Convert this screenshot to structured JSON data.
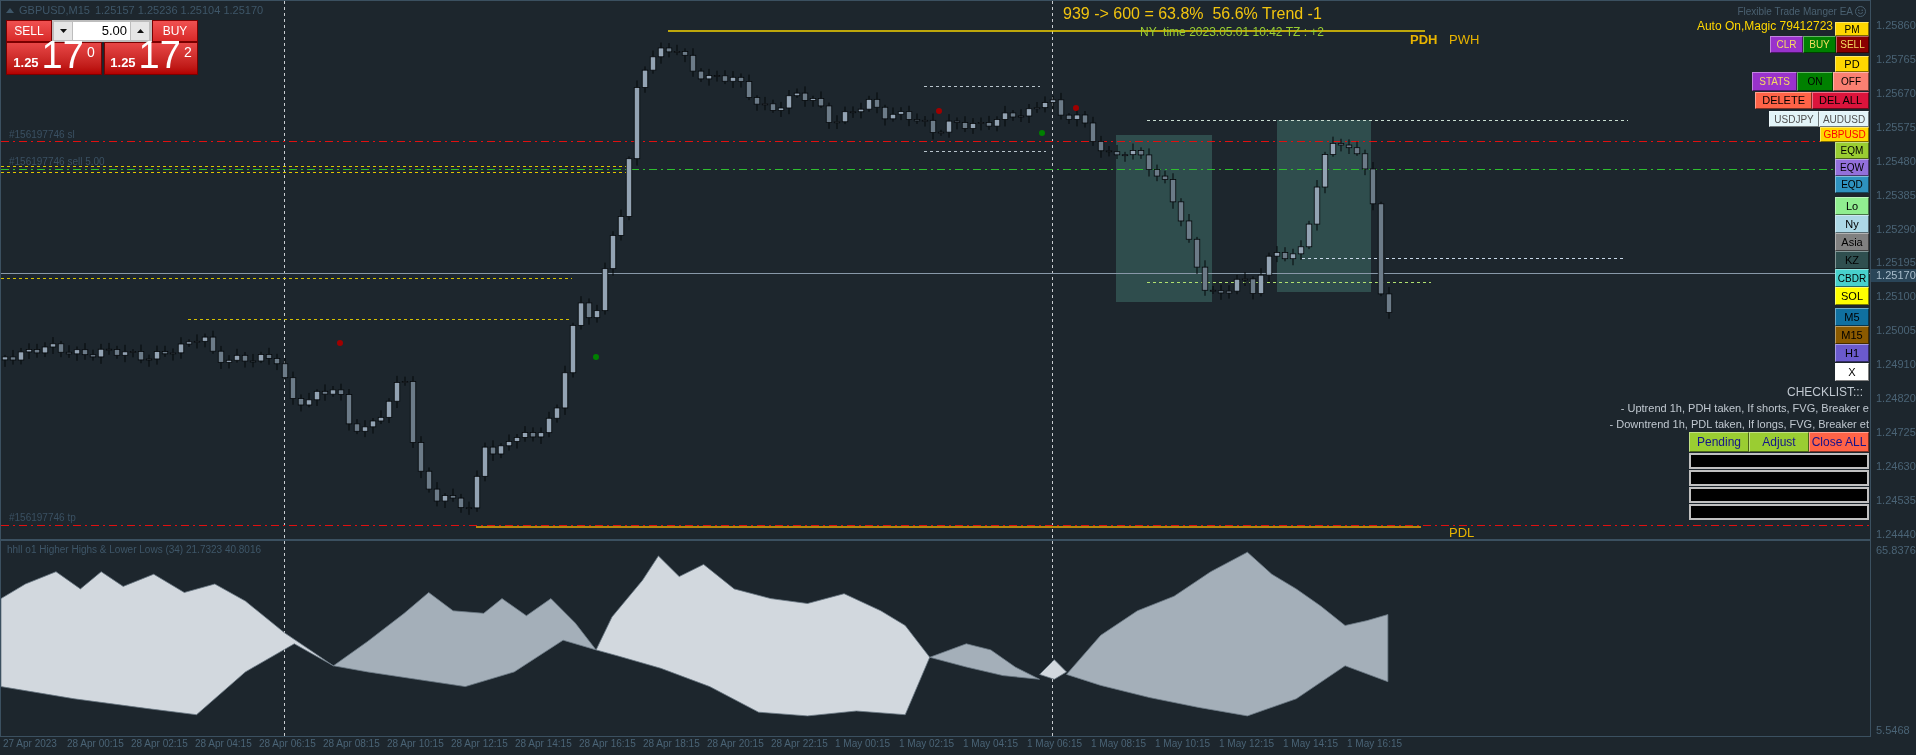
{
  "chart_header": {
    "symbol": "GBPUSD,M15",
    "quote": "1.25157 1.25236 1.25104 1.25170"
  },
  "one_click_trading": {
    "sell": {
      "label": "SELL",
      "price_prefix": "1.25",
      "price_pips": "17",
      "price_fraction": "0"
    },
    "buy": {
      "label": "BUY",
      "price_prefix": "1.25",
      "price_pips": "17",
      "price_fraction": "2"
    },
    "lot": "5.00"
  },
  "summary_text": "939 -> 600 = 63.8%  56.6% Trend -1",
  "session_time": "NY  time 2023.05.01 10:42 TZ : +2",
  "level_labels": [
    "PDH",
    "PWH",
    "PDL"
  ],
  "order_labels": [
    "#156197746 sl",
    "#156197746 sell 5.00",
    "#156197746 tp"
  ],
  "signal_dots": [
    {
      "color": "#a00000"
    },
    {
      "color": "#008000"
    },
    {
      "color": "#a00000"
    },
    {
      "color": "#008000"
    },
    {
      "color": "#a00000"
    }
  ],
  "ea_panel": {
    "title": "Flexible Trade Manger EA",
    "status": "Auto On,Magic 79412723",
    "button_rows": [
      [
        {
          "label": "PM",
          "kind": "plain",
          "color": "#ffd700"
        }
      ],
      [
        {
          "label": "CLR",
          "kind": "accent",
          "color": "#9932cc"
        },
        {
          "label": "BUY",
          "kind": "accent",
          "color": "#008000"
        },
        {
          "label": "SELL",
          "kind": "accent",
          "color": "#8b0000"
        }
      ],
      [
        {
          "label": "PD",
          "kind": "plain",
          "color": "#ffd700"
        }
      ],
      [
        {
          "label": "STATS",
          "kind": "accent",
          "color": "#9932cc"
        },
        {
          "label": "ON",
          "kind": "plain",
          "color": "#008000"
        },
        {
          "label": "OFF",
          "kind": "plain",
          "color": "#fa8072"
        }
      ],
      [
        {
          "label": "DELETE",
          "kind": "plain",
          "color": "#ff6347"
        },
        {
          "label": "DEL ALL",
          "kind": "plain",
          "color": "#dc143c"
        }
      ],
      [
        {
          "label": "USDJPY",
          "kind": "symbol",
          "selected": false
        },
        {
          "label": "AUDUSD",
          "kind": "symbol",
          "selected": false
        }
      ],
      [
        {
          "label": "GBPUSD",
          "kind": "symbol",
          "selected": true
        }
      ],
      [
        {
          "label": "EQM",
          "kind": "plain",
          "color": "#9acd32"
        }
      ],
      [
        {
          "label": "EQW",
          "kind": "plain",
          "color": "#9370db"
        }
      ],
      [
        {
          "label": "EQD",
          "kind": "plain",
          "color": "#2e92bf"
        }
      ],
      [
        {
          "label": "Lo",
          "kind": "plain",
          "color": "#90ee90"
        }
      ],
      [
        {
          "label": "Ny",
          "kind": "plain",
          "color": "#add8e6"
        }
      ],
      [
        {
          "label": "Asia",
          "kind": "plain",
          "color": "#808080"
        }
      ],
      [
        {
          "label": "KZ",
          "kind": "plain",
          "color": "#2f4f4f"
        }
      ],
      [
        {
          "label": "CBDR",
          "kind": "plain",
          "color": "#48d1cc"
        }
      ],
      [
        {
          "label": "SOL",
          "kind": "plain",
          "color": "#ffff00"
        }
      ],
      [
        {
          "label": "M5",
          "kind": "plain",
          "color": "#1070a0"
        }
      ],
      [
        {
          "label": "M15",
          "kind": "plain",
          "color": "#8b5a00"
        }
      ],
      [
        {
          "label": "H1",
          "kind": "plain",
          "color": "#6a5acd"
        }
      ],
      [
        {
          "label": "X",
          "kind": "plain",
          "color": "#ffffff"
        }
      ]
    ],
    "checklist": {
      "title": "CHECKLIST:::",
      "items": [
        "- Uptrend 1h, PDH taken, If shorts, FVG, Breaker e",
        "- Downtrend 1h, PDL taken, If longs, FVG, Breaker et"
      ]
    },
    "action_buttons": [
      {
        "label": "Pending",
        "color": "#9acd32"
      },
      {
        "label": "Adjust",
        "color": "#9acd32"
      },
      {
        "label": "Close ALL",
        "color": "#ff6347"
      }
    ]
  },
  "price_axis": {
    "labels": [
      "1.25860",
      "1.25765",
      "1.25670",
      "1.25575",
      "1.25480",
      "1.25385",
      "1.25290",
      "1.25195",
      "1.25100",
      "1.25005",
      "1.24910",
      "1.24820",
      "1.24725",
      "1.24630",
      "1.24535",
      "1.24440"
    ],
    "current_price": "1.25170"
  },
  "indicator": {
    "label": "hhll o1 Higher Highs & Lower Lows (34) 21.7323 40.8016",
    "axis_labels": [
      "65.8376",
      "5.5468"
    ]
  },
  "time_axis": [
    "27 Apr 2023",
    "28 Apr 00:15",
    "28 Apr 02:15",
    "28 Apr 04:15",
    "28 Apr 06:15",
    "28 Apr 08:15",
    "28 Apr 10:15",
    "28 Apr 12:15",
    "28 Apr 14:15",
    "28 Apr 16:15",
    "28 Apr 18:15",
    "28 Apr 20:15",
    "28 Apr 22:15",
    "1 May 00:15",
    "1 May 02:15",
    "1 May 04:15",
    "1 May 06:15",
    "1 May 08:15",
    "1 May 10:15",
    "1 May 12:15",
    "1 May 14:15",
    "1 May 16:15"
  ]
}
